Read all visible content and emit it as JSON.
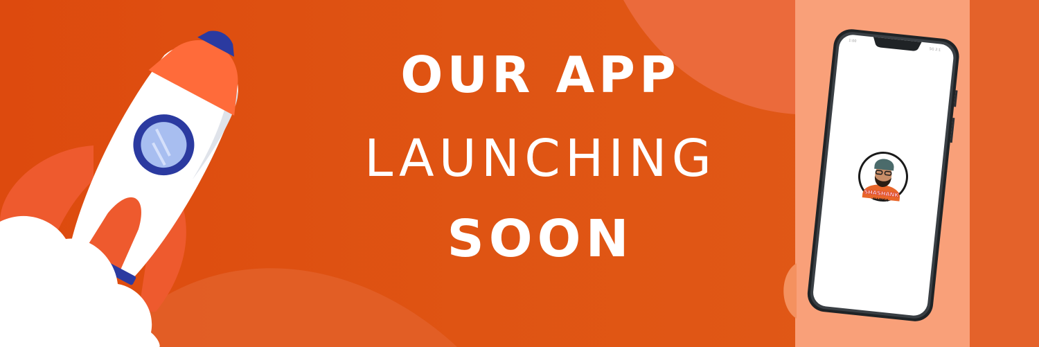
{
  "headline": {
    "line1": "OUR APP",
    "line2": "LAUNCHING",
    "line3": "SOON"
  },
  "phone": {
    "status_left": "1:00",
    "status_right": "5G 2:1",
    "logo_text_top": "SHASHANK",
    "logo_text_bottom": "ILLINGA"
  },
  "colors": {
    "background": "#df5413",
    "panel": "#f9a079",
    "rocket_body": "#ffffff",
    "rocket_nose": "#ff6b3a",
    "rocket_accent": "#2b3aa0",
    "flame": "#f5a623",
    "text": "#ffffff"
  },
  "icons": [
    "rocket-icon",
    "cloud-icon",
    "smartphone-icon",
    "avatar-logo-icon"
  ]
}
